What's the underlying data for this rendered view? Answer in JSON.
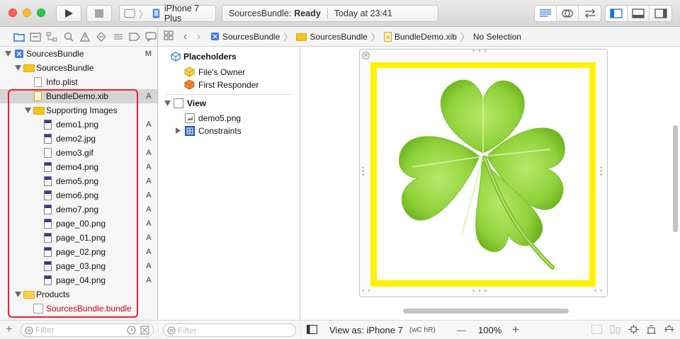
{
  "toolbar": {
    "run_icon": "play-icon",
    "stop_icon": "stop-icon",
    "scheme_device": "iPhone 7 Plus",
    "status_project": "SourcesBundle:",
    "status_state": "Ready",
    "status_time": "Today at 23:41"
  },
  "navigator": {
    "items": [
      {
        "label": "SourcesBundle",
        "badge": "M"
      },
      {
        "label": "SourcesBundle",
        "badge": ""
      },
      {
        "label": "Info.plist",
        "badge": ""
      },
      {
        "label": "BundleDemo.xib",
        "badge": "A"
      },
      {
        "label": "Supporting Images",
        "badge": ""
      },
      {
        "label": "demo1.png",
        "badge": "A"
      },
      {
        "label": "demo2.jpg",
        "badge": "A"
      },
      {
        "label": "demo3.gif",
        "badge": "A"
      },
      {
        "label": "demo4.png",
        "badge": "A"
      },
      {
        "label": "demo5.png",
        "badge": "A"
      },
      {
        "label": "demo6.png",
        "badge": "A"
      },
      {
        "label": "demo7.png",
        "badge": "A"
      },
      {
        "label": "page_00.png",
        "badge": "A"
      },
      {
        "label": "page_01.png",
        "badge": "A"
      },
      {
        "label": "page_02.png",
        "badge": "A"
      },
      {
        "label": "page_03.png",
        "badge": "A"
      },
      {
        "label": "page_04.png",
        "badge": "A"
      },
      {
        "label": "Products",
        "badge": ""
      },
      {
        "label": "SourcesBundle.bundle",
        "badge": ""
      }
    ],
    "filter_placeholder": "Filter"
  },
  "jumpbar": {
    "crumbs": [
      "SourcesBundle",
      "SourcesBundle",
      "BundleDemo.xib",
      "No Selection"
    ]
  },
  "outline": {
    "placeholders_header": "Placeholders",
    "files_owner": "File's Owner",
    "first_responder": "First Responder",
    "view_header": "View",
    "image_item": "demo5.png",
    "constraints": "Constraints",
    "filter_placeholder": "Filter"
  },
  "canvas": {
    "view_as_label": "View as: iPhone 7",
    "size_class": "(wC hR)",
    "zoom": "100%",
    "minus": "—",
    "plus": "+"
  },
  "colors": {
    "accent": "#1d6fe0",
    "highlight_border": "#e8202a",
    "image_view_background": "#fff200",
    "folder": "#f6c31c"
  }
}
